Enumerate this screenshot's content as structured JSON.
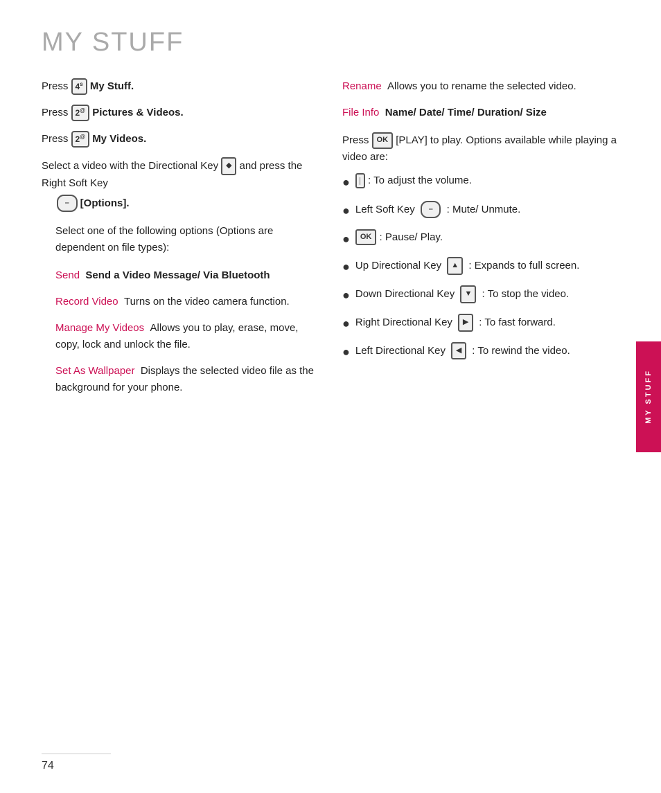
{
  "page": {
    "title": "MY STUFF",
    "page_number": "74",
    "sidebar_label": "MY STUFF"
  },
  "steps": {
    "step2": "Press",
    "step2_key": "4",
    "step2_label": "My Stuff.",
    "step3": "Press",
    "step3_key": "2",
    "step3_label": "Pictures & Videos.",
    "step4": "Press",
    "step4_key": "2",
    "step4_label": "My Videos.",
    "step5": "Select a video with the Directional Key",
    "step5_and": "and press the Right Soft Key",
    "step5_options": "[Options].",
    "select_text": "Select one of the following options (Options are dependent on file types):",
    "send_label": "Send",
    "send_desc": "Send a Video Message/ Via Bluetooth",
    "record_label": "Record Video",
    "record_desc": "Turns on the video camera function.",
    "manage_label": "Manage My Videos",
    "manage_desc": "Allows you to play, erase, move, copy, lock and unlock the file.",
    "wallpaper_label": "Set As Wallpaper",
    "wallpaper_desc": "Displays the selected video file as the background for your phone.",
    "rename_label": "Rename",
    "rename_desc": "Allows you to rename the selected video.",
    "fileinfo_label": "File Info",
    "fileinfo_desc": "Name/ Date/ Time/ Duration/ Size",
    "step6": "Press",
    "step6_key": "OK",
    "step6_label": "[PLAY] to play. Options available while playing a video are:",
    "bullet1": ": To adjust the volume.",
    "bullet2_pre": "Left Soft Key",
    "bullet2": ": Mute/ Unmute.",
    "bullet3": ": Pause/ Play.",
    "bullet4_pre": "Up Directional Key",
    "bullet4": ": Expands to full screen.",
    "bullet5_pre": "Down Directional Key",
    "bullet5": ": To stop the video.",
    "bullet6_pre": "Right Directional Key",
    "bullet6": ": To fast forward.",
    "bullet7_pre": "Left Directional Key",
    "bullet7": ": To rewind the video."
  }
}
